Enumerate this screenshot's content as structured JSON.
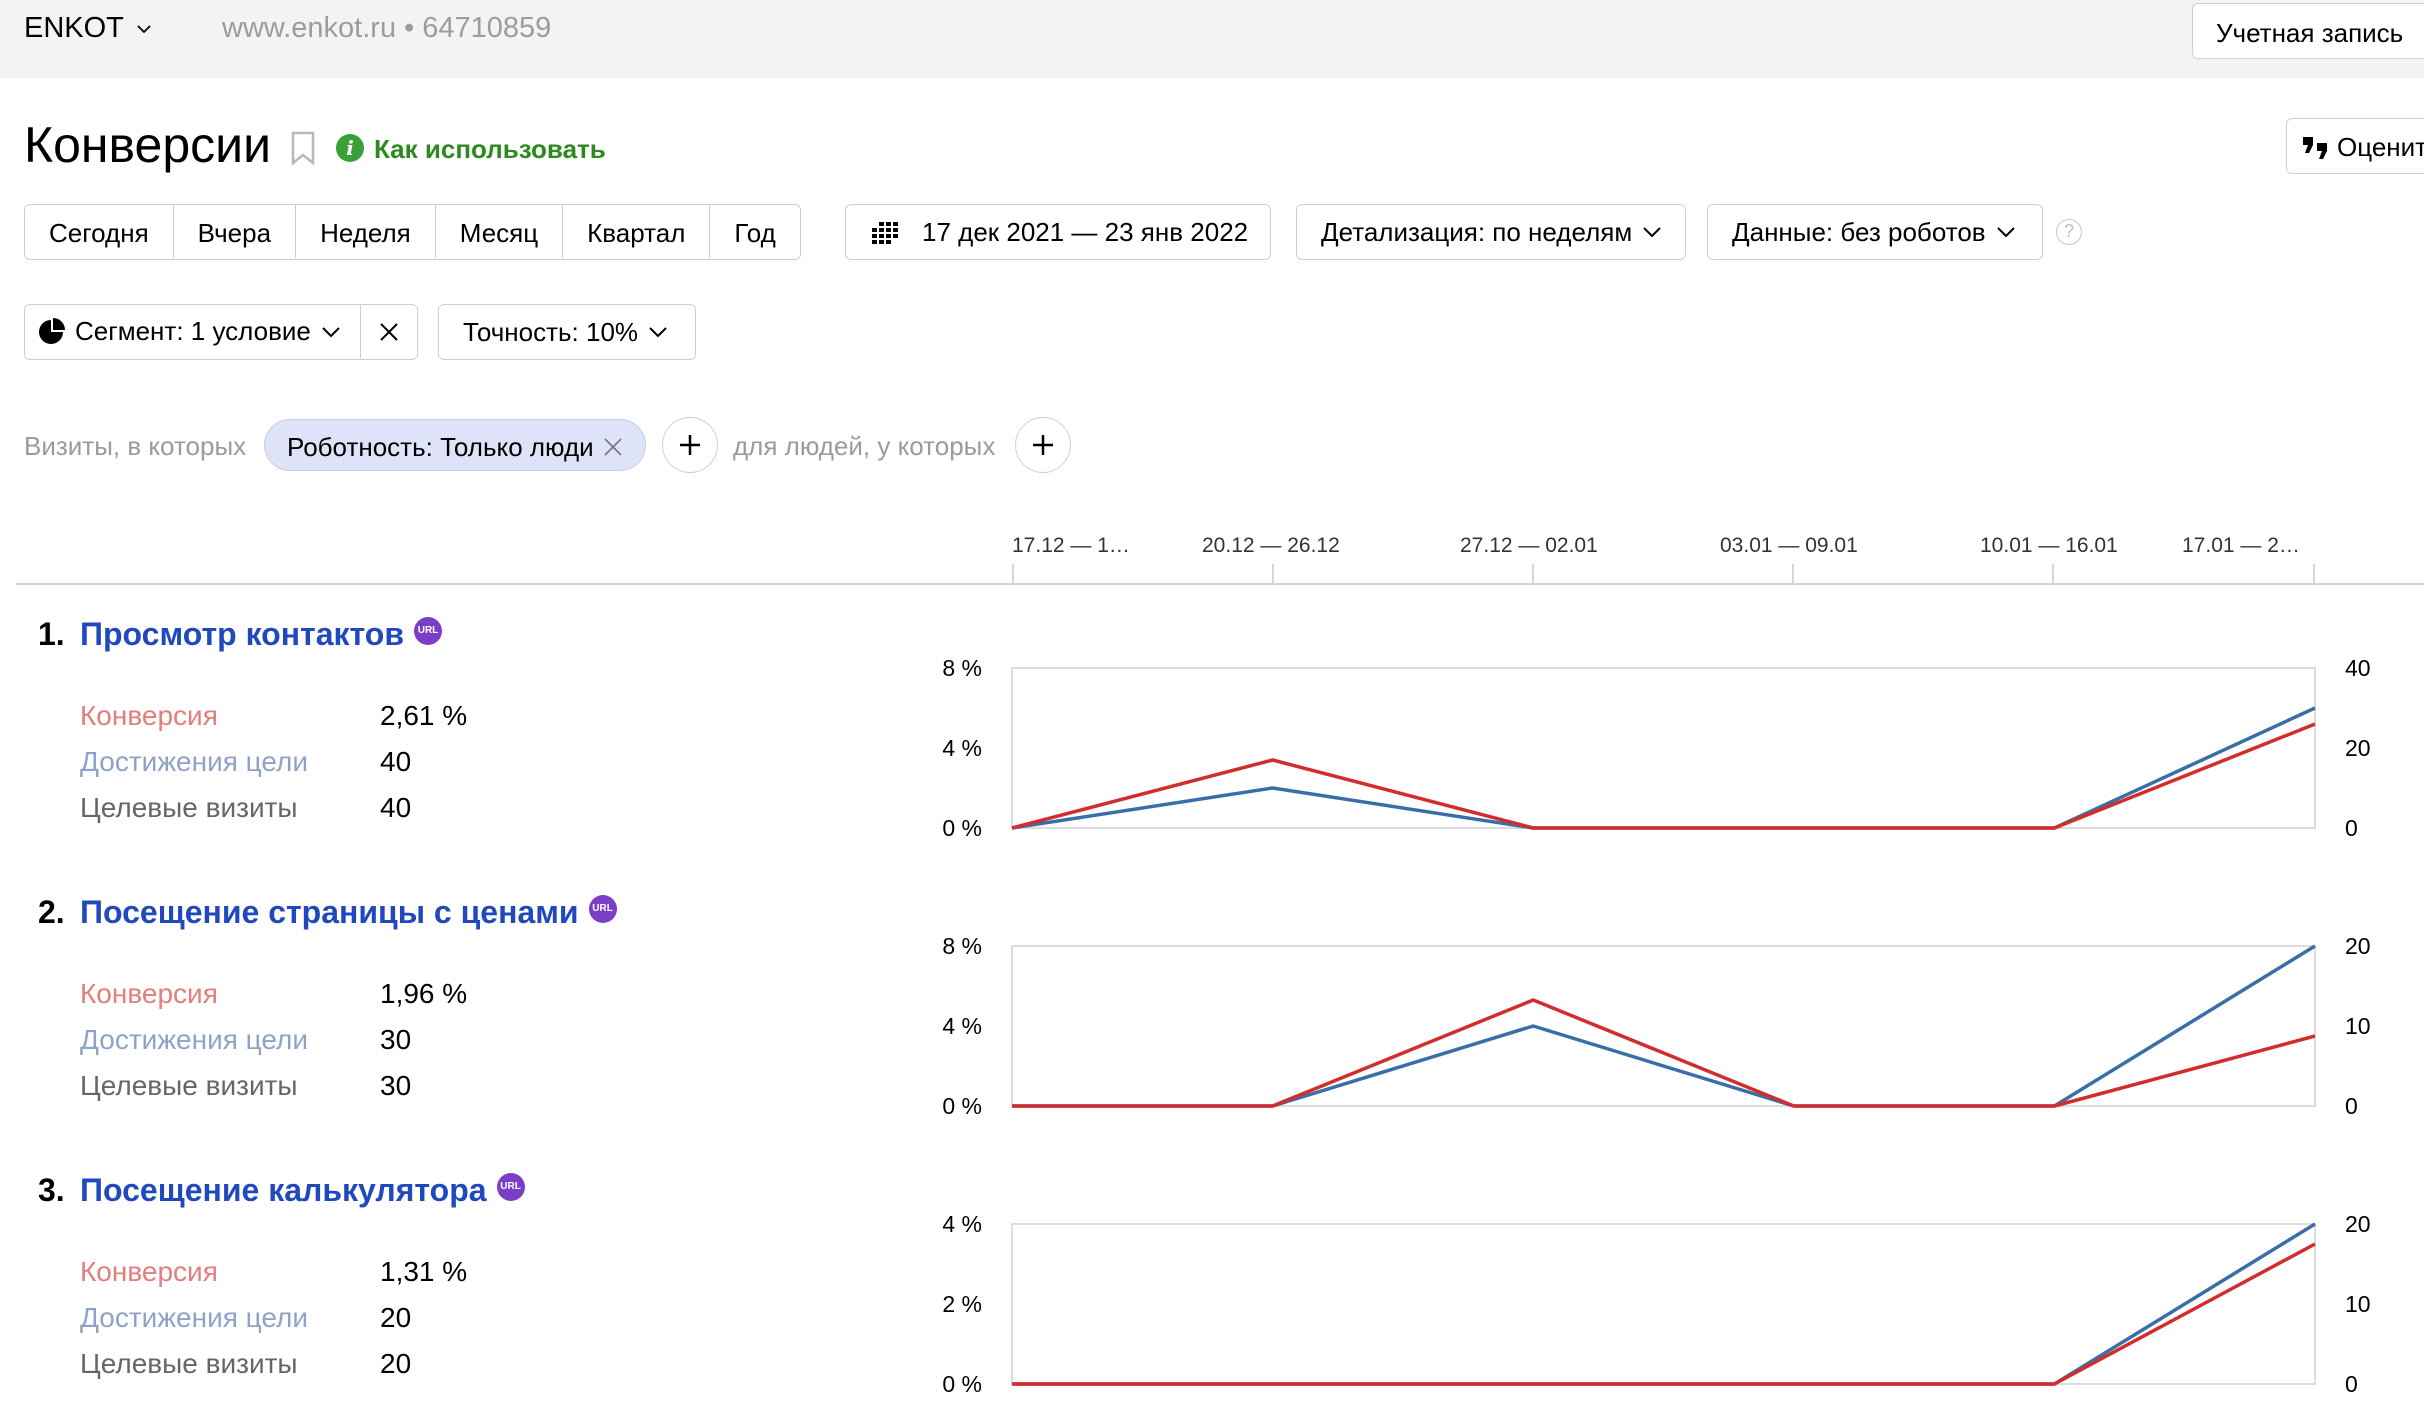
{
  "topbar": {
    "site_name": "ENKOT",
    "site_url": "www.enkot.ru",
    "separator": "•",
    "counter_id": "64710859",
    "account_label": "Учетная запись"
  },
  "header": {
    "title": "Конверсии",
    "help_link": "Как использовать",
    "rate_label": "Оценит"
  },
  "toolbar": {
    "periods": [
      "Сегодня",
      "Вчера",
      "Неделя",
      "Месяц",
      "Квартал",
      "Год"
    ],
    "date_range": "17 дек 2021 — 23 янв 2022",
    "detail": "Детализация: по неделям",
    "data_filter": "Данные: без роботов",
    "help": "?"
  },
  "segment": {
    "label": "Сегмент: 1 условие",
    "accuracy": "Точность: 10%"
  },
  "filter": {
    "visits_label": "Визиты, в которых",
    "chip_label": "Роботность: Только люди",
    "people_label": "для людей, у которых"
  },
  "timeline": {
    "weeks": [
      "17.12 — 1…",
      "20.12 — 26.12",
      "27.12 — 02.01",
      "03.01 — 09.01",
      "10.01 — 16.01",
      "17.01 — 2…"
    ]
  },
  "colors": {
    "conversion_line": "#d12d2d",
    "visits_line": "#3a6ea8",
    "goal_title": "#1f49bd",
    "url_badge": "#7b3fc6"
  },
  "goals": [
    {
      "num": "1.",
      "title": "Просмотр контактов",
      "badge": "URL",
      "metrics": [
        {
          "label": "Конверсия",
          "value": "2,61 %"
        },
        {
          "label": "Достижения цели",
          "value": "40"
        },
        {
          "label": "Целевые визиты",
          "value": "40"
        }
      ]
    },
    {
      "num": "2.",
      "title": "Посещение страницы с ценами",
      "badge": "URL",
      "metrics": [
        {
          "label": "Конверсия",
          "value": "1,96 %"
        },
        {
          "label": "Достижения цели",
          "value": "30"
        },
        {
          "label": "Целевые визиты",
          "value": "30"
        }
      ]
    },
    {
      "num": "3.",
      "title": "Посещение калькулятора",
      "badge": "URL",
      "metrics": [
        {
          "label": "Конверсия",
          "value": "1,31 %"
        },
        {
          "label": "Достижения цели",
          "value": "20"
        },
        {
          "label": "Целевые визиты",
          "value": "20"
        }
      ]
    }
  ],
  "chart_data": [
    {
      "type": "line",
      "categories": [
        "17.12 — 1…",
        "20.12 — 26.12",
        "27.12 — 02.01",
        "03.01 — 09.01",
        "10.01 — 16.01",
        "17.01 — 2…"
      ],
      "left_axis": {
        "ticks": [
          "0 %",
          "4 %",
          "8 %"
        ],
        "range": [
          0,
          8
        ]
      },
      "right_axis": {
        "ticks": [
          "0",
          "20",
          "40"
        ],
        "range": [
          0,
          40
        ]
      },
      "series": [
        {
          "axis": "left",
          "color": "#d12d2d",
          "values": [
            0,
            3.4,
            0,
            0,
            0,
            5.2
          ]
        },
        {
          "axis": "right",
          "color": "#3a6ea8",
          "values": [
            0,
            10,
            0,
            0,
            0,
            30
          ]
        }
      ]
    },
    {
      "type": "line",
      "categories": [
        "17.12 — 1…",
        "20.12 — 26.12",
        "27.12 — 02.01",
        "03.01 — 09.01",
        "10.01 — 16.01",
        "17.01 — 2…"
      ],
      "left_axis": {
        "ticks": [
          "0 %",
          "4 %",
          "8 %"
        ],
        "range": [
          0,
          8
        ]
      },
      "right_axis": {
        "ticks": [
          "0",
          "10",
          "20"
        ],
        "range": [
          0,
          20
        ]
      },
      "series": [
        {
          "axis": "left",
          "color": "#d12d2d",
          "values": [
            0,
            0,
            5.3,
            0,
            0,
            3.5
          ]
        },
        {
          "axis": "right",
          "color": "#3a6ea8",
          "values": [
            0,
            0,
            10,
            0,
            0,
            20
          ]
        }
      ]
    },
    {
      "type": "line",
      "categories": [
        "17.12 — 1…",
        "20.12 — 26.12",
        "27.12 — 02.01",
        "03.01 — 09.01",
        "10.01 — 16.01",
        "17.01 — 2…"
      ],
      "left_axis": {
        "ticks": [
          "0 %",
          "2 %",
          "4 %"
        ],
        "range": [
          0,
          4
        ]
      },
      "right_axis": {
        "ticks": [
          "0",
          "10",
          "20"
        ],
        "range": [
          0,
          20
        ]
      },
      "series": [
        {
          "axis": "left",
          "color": "#d12d2d",
          "values": [
            0,
            0,
            0,
            0,
            0,
            3.5
          ]
        },
        {
          "axis": "right",
          "color": "#3a6ea8",
          "values": [
            0,
            0,
            0,
            0,
            0,
            20
          ]
        }
      ]
    }
  ]
}
